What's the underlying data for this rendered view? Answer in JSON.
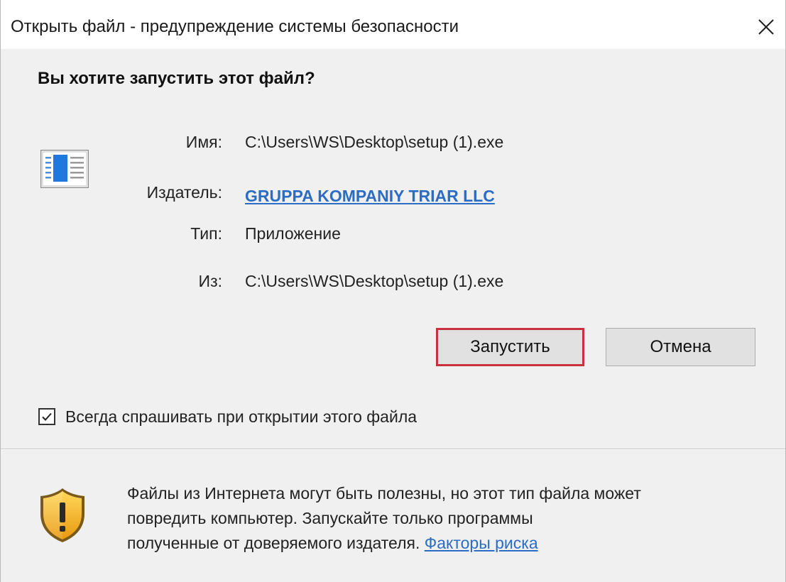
{
  "window": {
    "title": "Открыть файл - предупреждение системы безопасности",
    "close_icon": "close-icon"
  },
  "heading": "Вы хотите запустить этот файл?",
  "file_icon": "application-window-icon",
  "details": {
    "name_label": "Имя:",
    "name_value": "C:\\Users\\WS\\Desktop\\setup (1).exe",
    "publisher_label": "Издатель:",
    "publisher_value": "GRUPPA KOMPANIY TRIAR LLC",
    "type_label": "Тип:",
    "type_value": "Приложение",
    "from_label": "Из:",
    "from_value": "C:\\Users\\WS\\Desktop\\setup (1).exe"
  },
  "buttons": {
    "run_label": "Запустить",
    "cancel_label": "Отмена",
    "run_highlight_color": "#c7313b"
  },
  "checkbox": {
    "label": "Всегда спрашивать при открытии этого файла",
    "checked": true
  },
  "warning": {
    "icon": "shield-warning-icon",
    "line1": "Файлы из Интернета могут быть полезны, но этот тип файла может",
    "line2": "повредить компьютер. Запускайте только программы",
    "line3_text": "полученные от доверяемого издателя.",
    "risk_link": "Факторы риска"
  },
  "colors": {
    "link": "#2b6cc4",
    "dialog_bg": "#f0f0f0",
    "button_bg": "#e1e1e1"
  }
}
